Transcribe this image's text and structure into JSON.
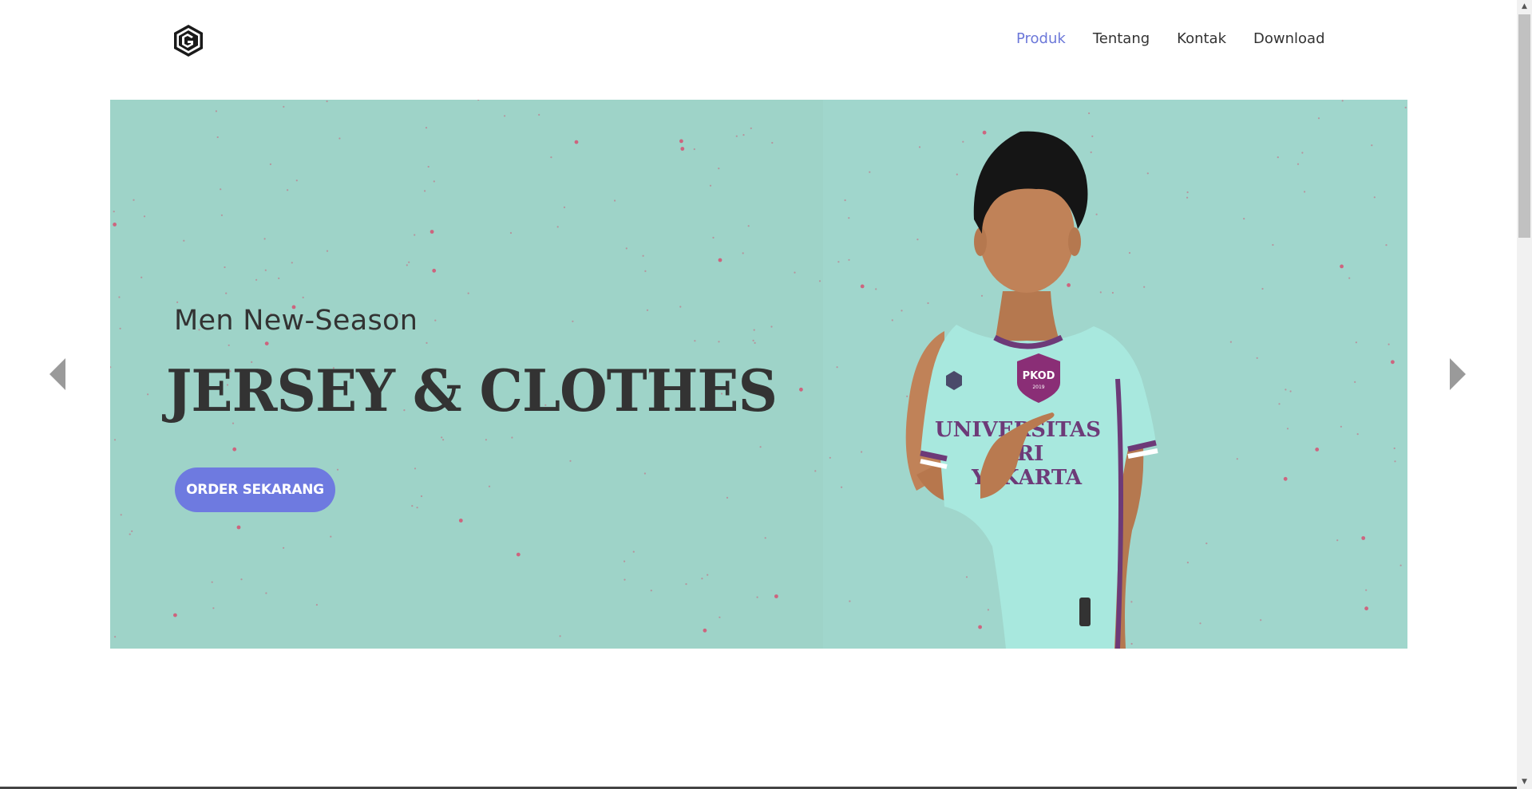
{
  "brand": {
    "logo_icon": "hexagon-g-logo-icon"
  },
  "nav": {
    "items": [
      {
        "label": "Produk",
        "active": true
      },
      {
        "label": "Tentang",
        "active": false
      },
      {
        "label": "Kontak",
        "active": false
      },
      {
        "label": "Download",
        "active": false
      }
    ]
  },
  "hero": {
    "subtitle": "Men New-Season",
    "title": "JERSEY & CLOTHES",
    "cta_label": "ORDER SEKARANG",
    "jersey_text": {
      "badge": "PKOD",
      "badge_year": "2019",
      "line1": "UNIVERSITAS",
      "line2": "ISRI",
      "line3": "YAKARTA"
    }
  },
  "carousel": {
    "prev_icon": "chevron-left-icon",
    "next_icon": "chevron-right-icon"
  },
  "colors": {
    "accent": "#6e7ae0",
    "active_nav": "#6c78d9",
    "hero_bg": "#9ed3c8",
    "text": "#333333"
  }
}
